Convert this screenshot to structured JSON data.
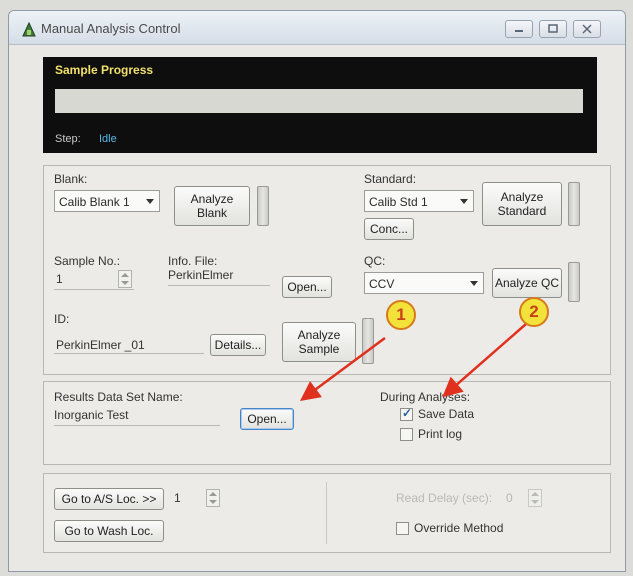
{
  "window": {
    "title": "Manual Analysis Control"
  },
  "progress": {
    "title": "Sample Progress",
    "step_label": "Step:",
    "step_value": "Idle"
  },
  "blank": {
    "label": "Blank:",
    "selected": "Calib Blank 1",
    "analyze_button": [
      "Analyze",
      "Blank"
    ]
  },
  "standard": {
    "label": "Standard:",
    "selected": "Calib Std 1",
    "analyze_button": [
      "Analyze",
      "Standard"
    ],
    "conc_button": "Conc..."
  },
  "sample": {
    "number_label": "Sample No.:",
    "number_value": "1",
    "info_label": "Info. File:",
    "info_value": "PerkinElmer",
    "open_button": "Open...",
    "id_label": "ID:",
    "id_value": "PerkinElmer _01",
    "details_button": "Details...",
    "analyze_button": [
      "Analyze",
      "Sample"
    ]
  },
  "qc": {
    "label": "QC:",
    "selected": "CCV",
    "analyze_button": "Analyze QC"
  },
  "results": {
    "label": "Results Data Set Name:",
    "value": "Inorganic Test",
    "open_button": "Open..."
  },
  "during": {
    "label": "During Analyses:",
    "save_data": "Save Data",
    "save_checked": true,
    "print_log": "Print log",
    "print_checked": false
  },
  "autosampler": {
    "goto_button": "Go to A/S Loc. >>",
    "loc_value": "1",
    "wash_button": "Go to Wash Loc.",
    "read_delay_label": "Read Delay (sec):",
    "read_delay_value": "0",
    "override_label": "Override Method"
  },
  "callouts": {
    "one": "1",
    "two": "2"
  },
  "colors": {
    "progress_title": "#f1e06b",
    "step_value": "#56b8e6",
    "marker_fill": "#f2e23a",
    "arrow": "#e0301e"
  }
}
